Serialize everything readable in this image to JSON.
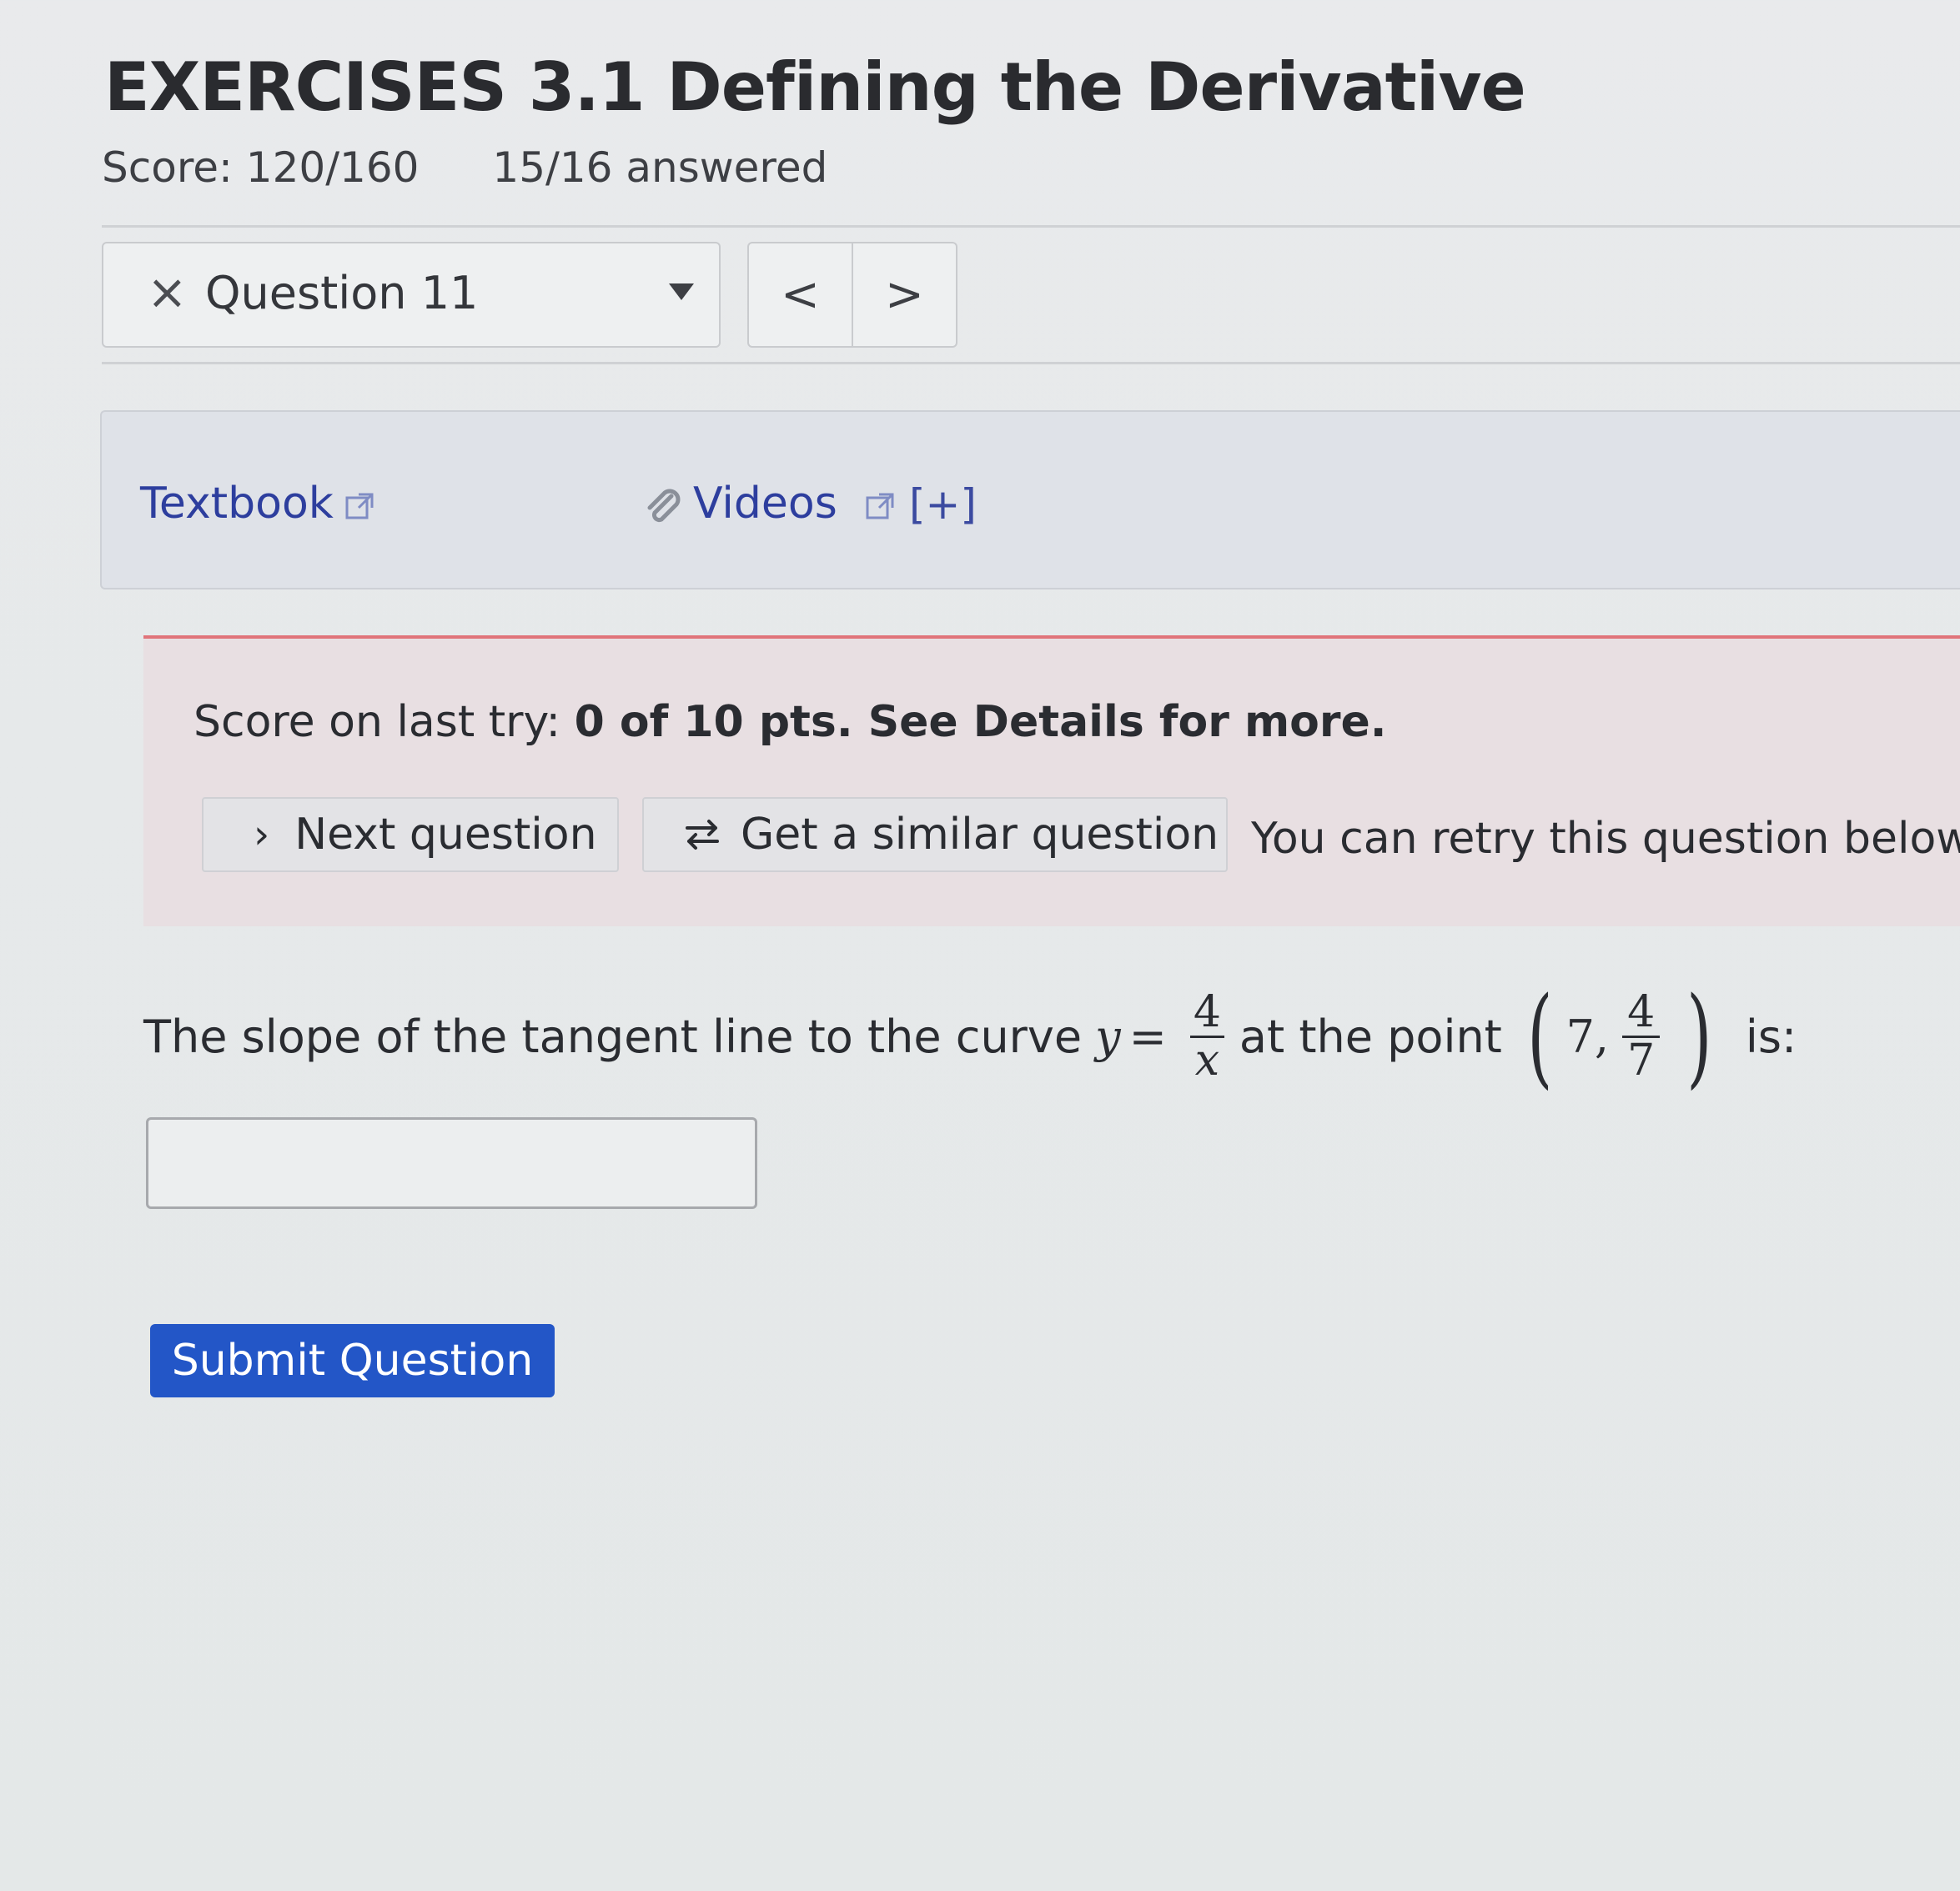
{
  "header": {
    "title": "EXERCISES 3.1 Defining the Derivative",
    "score": "Score: 120/160",
    "answered": "15/16 answered"
  },
  "question_nav": {
    "close_symbol": "×",
    "selected_question": "Question 11",
    "prev_symbol": "<",
    "next_symbol": ">"
  },
  "resources": {
    "textbook_label": "Textbook",
    "videos_label": "Videos",
    "expand_label": "[+]"
  },
  "feedback": {
    "prefix": "Score on last try: ",
    "score_text": "0 of 10 pts. See Details for more.",
    "next_button": "Next question",
    "similar_button": "Get a similar question",
    "retry_text": "You can retry this question below"
  },
  "question": {
    "text_before": "The slope of the tangent line to the curve",
    "var_y": "y",
    "equals": "=",
    "frac_num": "4",
    "frac_den": "x",
    "text_mid": "at the point",
    "point_x": "7,",
    "point_frac_num": "4",
    "point_frac_den": "7",
    "text_after": "is:",
    "answer_value": ""
  },
  "submit_label": "Submit Question",
  "colors": {
    "link": "#2d3e9e",
    "submit_bg": "#2356c7",
    "feedback_border": "#e0747a",
    "feedback_bg": "#e8dfe2"
  }
}
